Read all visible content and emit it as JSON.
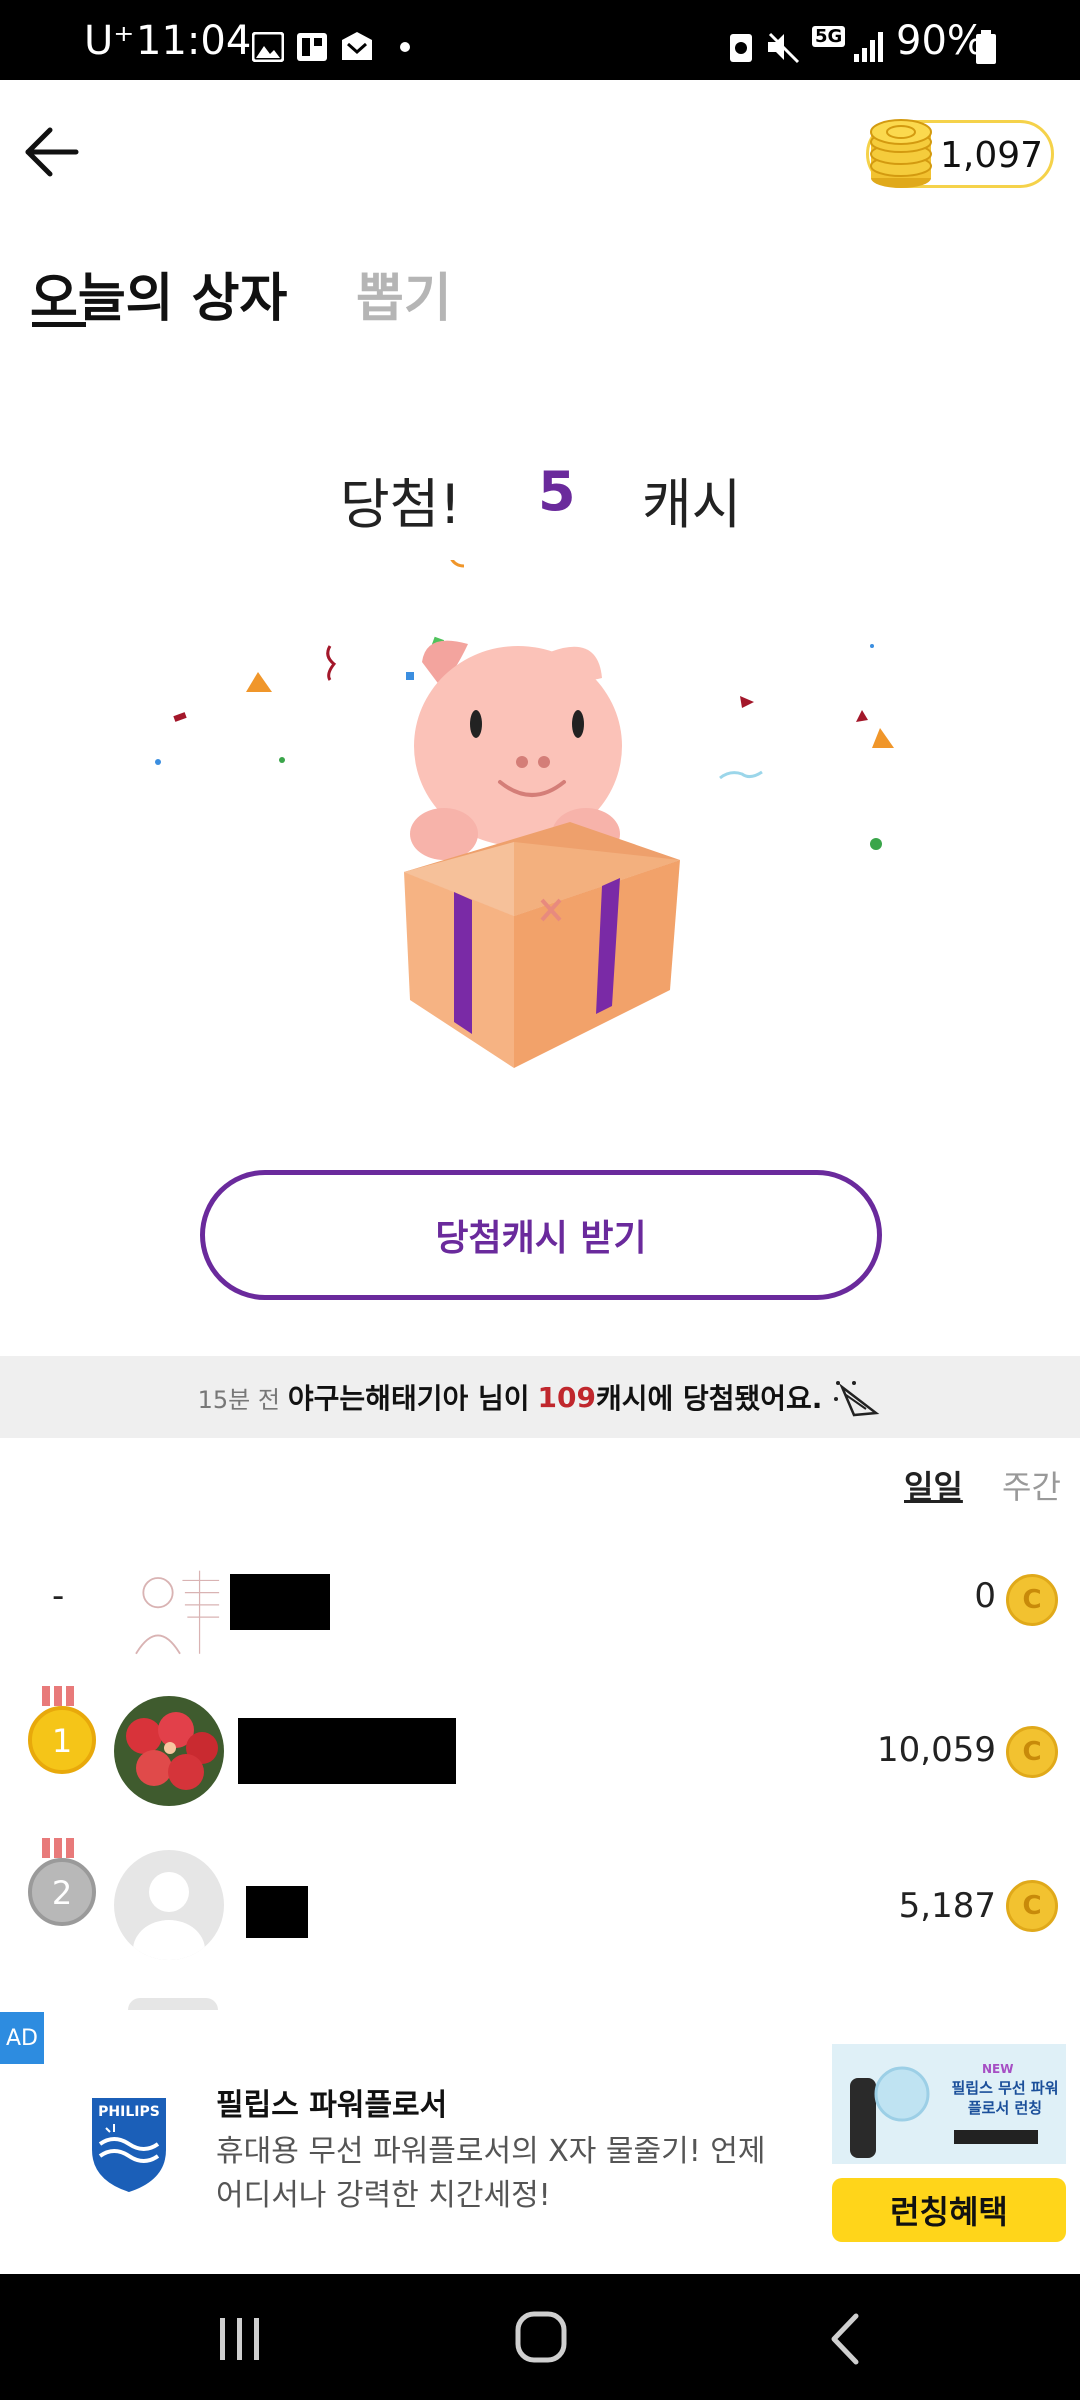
{
  "status_bar": {
    "carrier": "U⁺",
    "time": "11:04",
    "network": "5G",
    "battery": "90%"
  },
  "header": {
    "coin_count": "1,097"
  },
  "tabs": [
    {
      "label": "오늘의 상자",
      "active": true
    },
    {
      "label": "뽑기",
      "active": false
    }
  ],
  "result": {
    "label": "당첨!",
    "amount": "5",
    "unit": "캐시"
  },
  "claim_button": "당첨캐시 받기",
  "ticker": {
    "time": "15분 전",
    "name_text": "야구는해태기아 님이",
    "amount": "109",
    "suffix": "캐시에 당첨됐어요."
  },
  "period_tabs": {
    "daily": "일일",
    "weekly": "주간"
  },
  "ranking": [
    {
      "rank": "-",
      "score": "0"
    },
    {
      "rank": "1",
      "score": "10,059"
    },
    {
      "rank": "2",
      "score": "5,187"
    }
  ],
  "ad": {
    "badge": "AD",
    "brand_logo_text": "PHILIPS",
    "title": "필립스 파워플로서",
    "description": "휴대용 무선 파워플로서의 X자 물줄기! 언제 어디서나 강력한 치간세정!",
    "cta": "런칭혜택",
    "thumb_new": "NEW",
    "thumb_title": "필립스 무선 파워플로서 런칭"
  },
  "colors": {
    "accent": "#6a2a9c",
    "coin": "#f2c230",
    "ticker_red": "#c0272d",
    "ad_cta": "#ffd51a"
  }
}
